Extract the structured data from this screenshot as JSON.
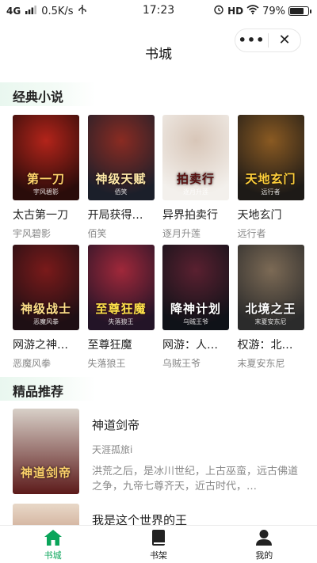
{
  "status_bar": {
    "network": "4G",
    "speed": "0.5K/s",
    "time": "17:23",
    "hd": "HD",
    "battery": "79%",
    "battery_level": 0.79
  },
  "header": {
    "title": "书城",
    "more_label": "•••",
    "close_label": "✕"
  },
  "classics": {
    "heading": "经典小说",
    "books": [
      {
        "name": "太古第一刀",
        "author": "宇风碧影",
        "cover_text": "第一刀",
        "c1": "#2a0c0a",
        "c2": "#b3241a",
        "tc": "#ffd36b"
      },
      {
        "name": "开局获得…",
        "author": "佰笑",
        "cover_text": "神级天赋",
        "c1": "#1b1f2a",
        "c2": "#8a2b22",
        "tc": "#ffe9a8"
      },
      {
        "name": "异界拍卖行",
        "author": "逐月升莲",
        "cover_text": "拍卖行",
        "c1": "#f3f0ec",
        "c2": "#d8c6b8",
        "tc": "#5a1010"
      },
      {
        "name": "天地玄门",
        "author": "远行者",
        "cover_text": "天地玄门",
        "c1": "#1d1a17",
        "c2": "#8a5a22",
        "tc": "#ffcf3a"
      },
      {
        "name": "网游之神…",
        "author": "恶魔风拳",
        "cover_text": "神级战士",
        "c1": "#1e0f14",
        "c2": "#7a1a1a",
        "tc": "#ffe08a"
      },
      {
        "name": "至尊狂魔",
        "author": "失落狼王",
        "cover_text": "至尊狂魔",
        "c1": "#231427",
        "c2": "#a0283a",
        "tc": "#ffe14a"
      },
      {
        "name": "网游：人…",
        "author": "乌贼王爷",
        "cover_text": "降神计划",
        "c1": "#0f1218",
        "c2": "#5a2030",
        "tc": "#ffffff"
      },
      {
        "name": "权游：北…",
        "author": "末夏安东尼",
        "cover_text": "北境之王",
        "c1": "#2b2b2b",
        "c2": "#7c6a55",
        "tc": "#ffffff"
      }
    ]
  },
  "featured": {
    "heading": "精品推荐",
    "items": [
      {
        "title": "神道剑帝",
        "author": "天涯孤旅i",
        "intro": "洪荒之后，是冰川世纪，上古巫蛮，远古佛道之争，九帝七尊齐天，近古时代，…",
        "cover_text": "神道剑帝",
        "c1": "#d8d0c8",
        "c2": "#5c1a1a",
        "tc": "#ffd36b"
      },
      {
        "title": "我是这个世界的王",
        "cover_text": "",
        "c1": "#e8d8c8",
        "c2": "#a05a3a",
        "tc": "#ffffff"
      }
    ]
  },
  "tabbar": {
    "items": [
      {
        "label": "书城",
        "icon": "home-icon",
        "active": true
      },
      {
        "label": "书架",
        "icon": "book-icon",
        "active": false
      },
      {
        "label": "我的",
        "icon": "user-icon",
        "active": false
      }
    ]
  },
  "colors": {
    "accent": "#0aa55a",
    "section_band": "#e9f7ef"
  }
}
